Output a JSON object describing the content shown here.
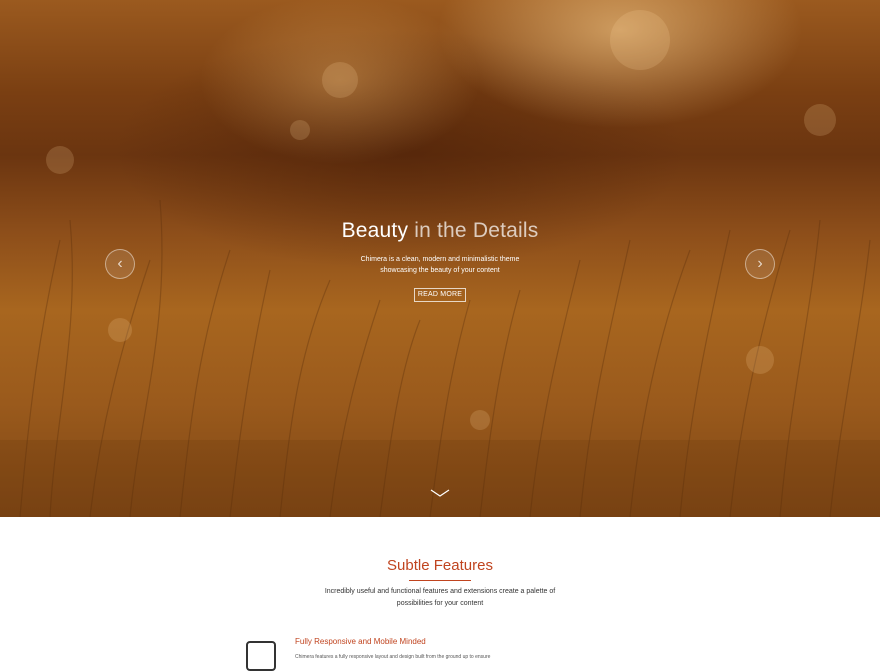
{
  "hero": {
    "title_bold": "Beauty",
    "title_light": "in the Details",
    "subtitle_line1": "Chimera is a clean, modern and minimalistic theme",
    "subtitle_line2": "showcasing the beauty of your content",
    "button_label": "READ MORE",
    "prev_icon": "chevron-left-icon",
    "next_icon": "chevron-right-icon",
    "scroll_icon": "chevron-down-icon"
  },
  "features": {
    "title": "Subtle Features",
    "desc_line1": "Incredibly useful and functional features and extensions create a palette of",
    "desc_line2": "possibilities for your content",
    "items": [
      {
        "icon": "mobile-device-icon",
        "title": "Fully Responsive and Mobile Minded",
        "text": "Chimera features a fully responsive layout and design built from the ground up to ensure"
      }
    ]
  },
  "colors": {
    "accent": "#c0441f",
    "hero_tint": "#8d4e1a",
    "text": "#333333"
  }
}
